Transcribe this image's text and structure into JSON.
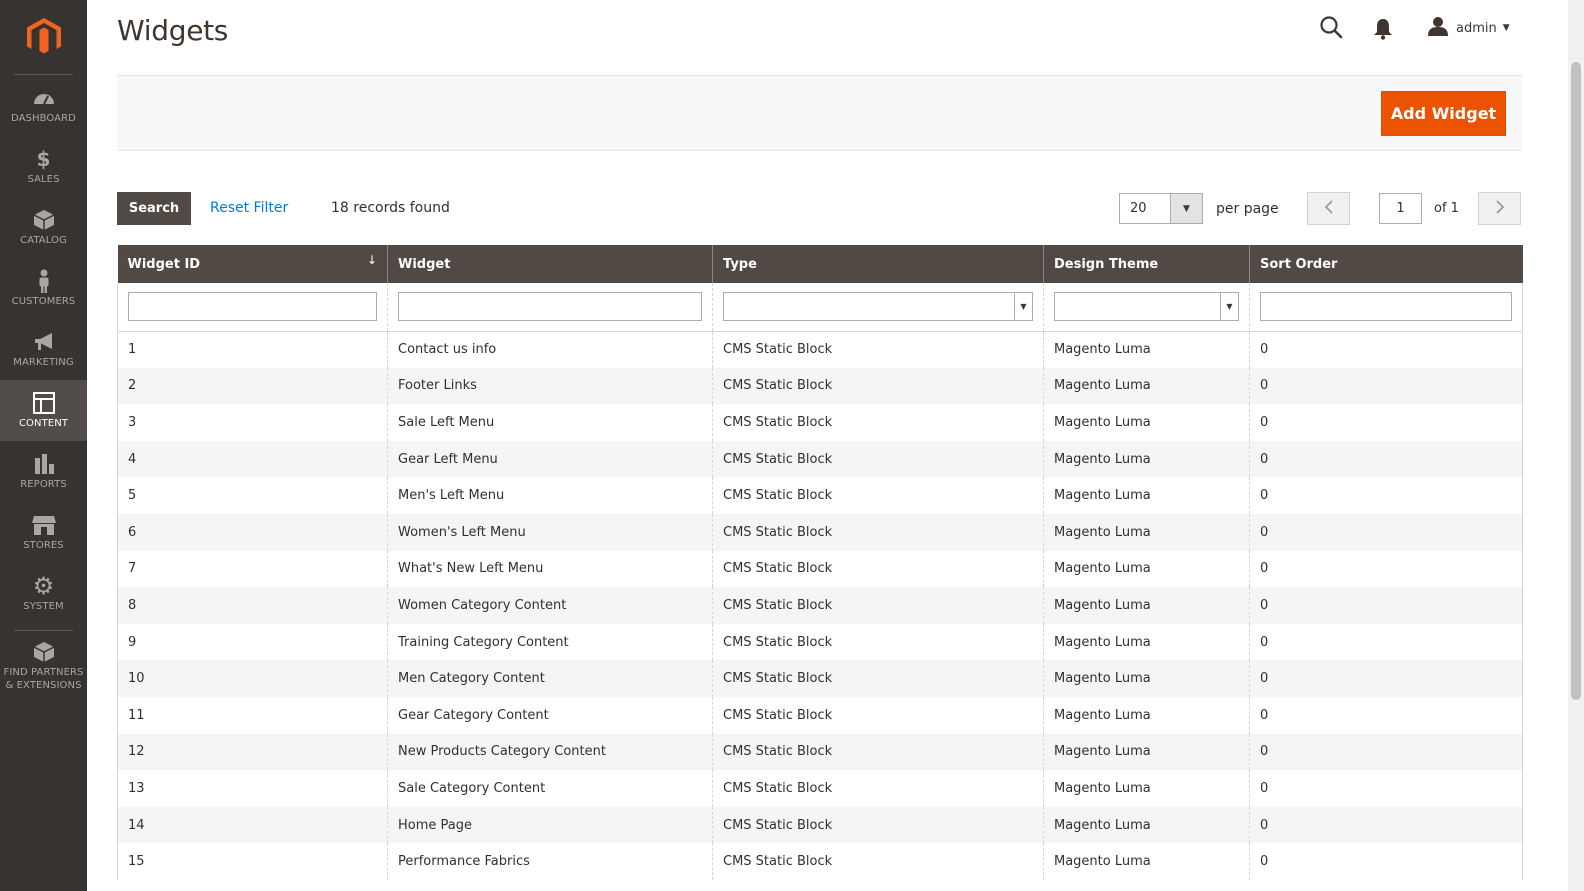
{
  "sidebar": {
    "logo": "magento-logo",
    "items": [
      {
        "label": "DASHBOARD",
        "icon": "dashboard-icon"
      },
      {
        "label": "SALES",
        "icon": "dollar-icon"
      },
      {
        "label": "CATALOG",
        "icon": "box-icon"
      },
      {
        "label": "CUSTOMERS",
        "icon": "person-icon"
      },
      {
        "label": "MARKETING",
        "icon": "megaphone-icon"
      },
      {
        "label": "CONTENT",
        "icon": "layout-icon",
        "active": true
      },
      {
        "label": "REPORTS",
        "icon": "bar-chart-icon"
      },
      {
        "label": "STORES",
        "icon": "storefront-icon"
      },
      {
        "label": "SYSTEM",
        "icon": "gear-icon"
      },
      {
        "label": "FIND PARTNERS & EXTENSIONS",
        "icon": "partners-box-icon"
      }
    ]
  },
  "header": {
    "title": "Widgets",
    "user": "admin"
  },
  "actions": {
    "add_label": "Add Widget"
  },
  "toolbar": {
    "search_label": "Search",
    "reset_label": "Reset Filter",
    "records_text": "18 records found",
    "per_page_value": "20",
    "per_page_label": "per page",
    "page_value": "1",
    "page_of": "of 1"
  },
  "grid": {
    "columns": [
      "Widget ID",
      "Widget",
      "Type",
      "Design Theme",
      "Sort Order"
    ],
    "rows": [
      [
        "1",
        "Contact us info",
        "CMS Static Block",
        "Magento Luma",
        "0"
      ],
      [
        "2",
        "Footer Links",
        "CMS Static Block",
        "Magento Luma",
        "0"
      ],
      [
        "3",
        "Sale Left Menu",
        "CMS Static Block",
        "Magento Luma",
        "0"
      ],
      [
        "4",
        "Gear Left Menu",
        "CMS Static Block",
        "Magento Luma",
        "0"
      ],
      [
        "5",
        "Men's Left Menu",
        "CMS Static Block",
        "Magento Luma",
        "0"
      ],
      [
        "6",
        "Women's Left Menu",
        "CMS Static Block",
        "Magento Luma",
        "0"
      ],
      [
        "7",
        "What's New Left Menu",
        "CMS Static Block",
        "Magento Luma",
        "0"
      ],
      [
        "8",
        "Women Category Content",
        "CMS Static Block",
        "Magento Luma",
        "0"
      ],
      [
        "9",
        "Training Category Content",
        "CMS Static Block",
        "Magento Luma",
        "0"
      ],
      [
        "10",
        "Men Category Content",
        "CMS Static Block",
        "Magento Luma",
        "0"
      ],
      [
        "11",
        "Gear Category Content",
        "CMS Static Block",
        "Magento Luma",
        "0"
      ],
      [
        "12",
        "New Products Category Content",
        "CMS Static Block",
        "Magento Luma",
        "0"
      ],
      [
        "13",
        "Sale Category Content",
        "CMS Static Block",
        "Magento Luma",
        "0"
      ],
      [
        "14",
        "Home Page",
        "CMS Static Block",
        "Magento Luma",
        "0"
      ],
      [
        "15",
        "Performance Fabrics",
        "CMS Static Block",
        "Magento Luma",
        "0"
      ]
    ]
  },
  "colors": {
    "sidebar_bg": "#373330",
    "accent": "#eb5202",
    "header_bg": "#514943",
    "link": "#007bdb"
  }
}
